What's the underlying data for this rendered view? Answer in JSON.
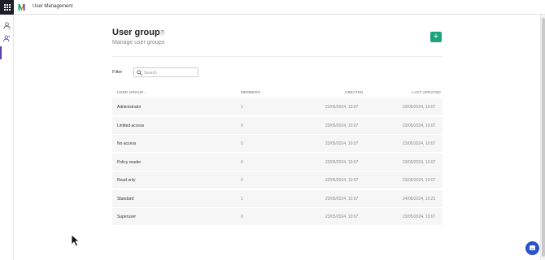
{
  "topbar": {
    "app_title": "User Management"
  },
  "page": {
    "title": "User groups",
    "help": "?",
    "subtitle": "Manage user groups",
    "add_label": "+"
  },
  "filter": {
    "label": "Filter",
    "placeholder": "Search",
    "value": ""
  },
  "table": {
    "headers": {
      "group": "USER GROUP ↓",
      "members": "MEMBERS",
      "created": "CREATED",
      "updated": "LAST UPDATED"
    },
    "rows": [
      {
        "name": "Administrator",
        "members": "1",
        "created": "23/05/2024, 10:07",
        "updated": "23/05/2024, 10:07"
      },
      {
        "name": "Limited access",
        "members": "0",
        "created": "23/05/2024, 10:07",
        "updated": "23/05/2024, 10:07"
      },
      {
        "name": "No access",
        "members": "0",
        "created": "23/05/2024, 10:07",
        "updated": "23/05/2024, 10:07"
      },
      {
        "name": "Policy reader",
        "members": "0",
        "created": "23/05/2024, 10:07",
        "updated": "23/05/2024, 10:07"
      },
      {
        "name": "Read only",
        "members": "0",
        "created": "23/05/2024, 10:07",
        "updated": "23/05/2024, 10:07"
      },
      {
        "name": "Standard",
        "members": "1",
        "created": "23/05/2024, 10:07",
        "updated": "24/05/2024, 15:21"
      },
      {
        "name": "Superuser",
        "members": "0",
        "created": "23/05/2024, 10:07",
        "updated": "23/05/2024, 10:07"
      }
    ]
  },
  "colors": {
    "accent": "#5b3fa8",
    "add_button": "#1aa37a",
    "chat_button": "#2d53c8",
    "apps_bg": "#1c1f2a"
  },
  "icons": {
    "apps": "apps-grid-icon",
    "logo": "app-logo",
    "user": "user-icon",
    "user_group": "user-group-icon",
    "search": "search-icon",
    "help": "help-icon",
    "add": "plus-icon",
    "chat": "chat-icon"
  }
}
